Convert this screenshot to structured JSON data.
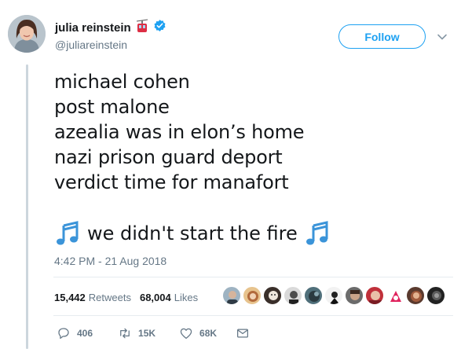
{
  "user": {
    "display_name": "julia reinstein",
    "handle": "@juliareinstein",
    "follow_label": "Follow"
  },
  "tweet": {
    "lines": [
      "michael cohen",
      "post malone",
      "azealia was in elon’s home",
      "nazi prison guard deport",
      "verdict time for manafort"
    ],
    "fire_text": "we didn't start the fire",
    "timestamp": "4:42 PM - 21 Aug 2018"
  },
  "stats": {
    "retweets_count": "15,442",
    "retweets_label": "Retweets",
    "likes_count": "68,004",
    "likes_label": "Likes"
  },
  "actions": {
    "replies": "406",
    "retweets": "15K",
    "likes": "68K"
  },
  "colors": {
    "accent": "#1da1f2",
    "secondary_text": "#657786",
    "thread_line": "#ccd6dd"
  },
  "icons": [
    "gondola-emoji-icon",
    "verified-badge-icon",
    "chevron-down-icon",
    "musical-notes-icon",
    "reply-icon",
    "retweet-icon",
    "like-icon",
    "message-icon"
  ]
}
